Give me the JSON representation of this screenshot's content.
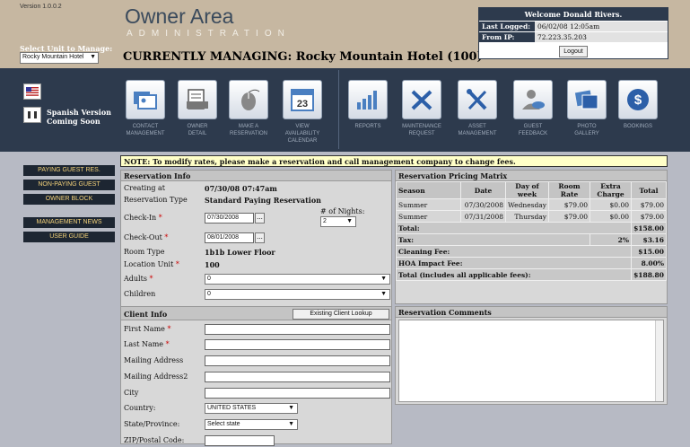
{
  "header": {
    "version": "Version 1.0.0.2",
    "logo_title": "Owner Area",
    "logo_subtitle": "ADMINISTRATION",
    "unit_label": "Select Unit to Manage:",
    "unit_selected": "Rocky Mountain Hotel",
    "currently_managing": "CURRENTLY MANAGING: Rocky Mountain Hotel (100)",
    "welcome": "Welcome Donald Rivers.",
    "last_logged_label": "Last Logged:",
    "last_logged_value": "06/02/08 12:05am",
    "from_ip_label": "From IP:",
    "from_ip_value": "72.223.35.203",
    "logout_label": "Logout"
  },
  "nav": {
    "spanish": "Spanish Version",
    "coming_soon": "Coming Soon",
    "items": [
      {
        "label": "CONTACT",
        "label2": "MANAGEMENT"
      },
      {
        "label": "OWNER",
        "label2": "DETAIL"
      },
      {
        "label": "MAKE A",
        "label2": "RESERVATION"
      },
      {
        "label": "VIEW",
        "label2": "AVAILABILITY",
        "label3": "CALENDAR",
        "icon_text": "23"
      },
      {
        "label": "REPORTS"
      },
      {
        "label": "MAINTENANCE",
        "label2": "REQUEST"
      },
      {
        "label": "ASSET",
        "label2": "MANAGEMENT"
      },
      {
        "label": "GUEST",
        "label2": "FEEDBACK"
      },
      {
        "label": "PHOTO",
        "label2": "GALLERY"
      },
      {
        "label": "BOOKINGS"
      }
    ]
  },
  "left_menu": [
    "PAYING GUEST RES.",
    "NON-PAYING GUEST",
    "OWNER BLOCK",
    "MANAGEMENT NEWS",
    "USER GUIDE"
  ],
  "note": "NOTE: To modify rates, please make a reservation and call management company to change fees.",
  "reservation": {
    "title": "Reservation Info",
    "creating_at_label": "Creating at",
    "creating_at_value": "07/30/08 07:47am",
    "type_label": "Reservation Type",
    "type_value": "Standard Paying Reservation",
    "checkin_label": "Check-In",
    "checkin_value": "07/30/2008",
    "nights_label": "# of Nights:",
    "nights_value": "2",
    "checkout_label": "Check-Out",
    "checkout_value": "08/01/2008",
    "room_type_label": "Room Type",
    "room_type_value": "1b1b Lower Floor",
    "location_label": "Location Unit",
    "location_value": "100",
    "adults_label": "Adults",
    "adults_value": "0",
    "children_label": "Children",
    "children_value": "0",
    "dots": "...",
    "req": "*"
  },
  "client": {
    "title": "Client Info",
    "lookup_label": "Existing Client Lookup",
    "first_name": "First Name",
    "last_name": "Last Name",
    "mailing": "Mailing Address",
    "mailing2": "Mailing Address2",
    "city": "City",
    "country_label": "Country:",
    "country_value": "UNITED STATES",
    "state_label": "State/Province:",
    "state_value": "Select state",
    "zip_label": "ZIP/Postal Code:"
  },
  "pricing": {
    "title": "Reservation Pricing Matrix",
    "headers": [
      "Season",
      "Date",
      "Day of week",
      "Room Rate",
      "Extra Charge",
      "Total"
    ],
    "rows": [
      [
        "Summer",
        "07/30/2008",
        "Wednesday",
        "$79.00",
        "$0.00",
        "$79.00"
      ],
      [
        "Summer",
        "07/31/2008",
        "Thursday",
        "$79.00",
        "$0.00",
        "$79.00"
      ]
    ],
    "total_label": "Total:",
    "total_value": "$158.00",
    "tax_label": "Tax:",
    "tax_pct": "2%",
    "tax_value": "$3.16",
    "cleaning_label": "Cleaning Fee:",
    "cleaning_value": "$15.00",
    "hoa_label": "HOA Impact Fee:",
    "hoa_value": "8.00%",
    "grand_label": "Total (includes all applicable fees):",
    "grand_value": "$188.80"
  },
  "comments": {
    "title": "Reservation Comments"
  }
}
